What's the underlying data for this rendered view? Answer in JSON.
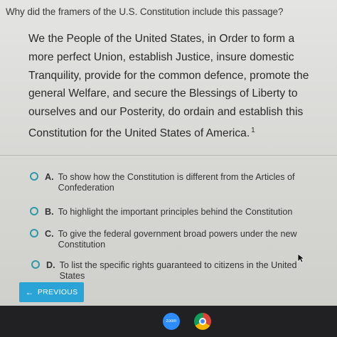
{
  "question": "Why did the framers of the U.S. Constitution include this passage?",
  "passage": {
    "text": "We the People of the United States, in Order to form a more perfect Union, establish Justice, insure domestic Tranquility, provide for the common defence, promote the general Welfare, and secure the Blessings of Liberty to ourselves and our Posterity, do ordain and establish this Constitution for the United States of America.",
    "footnote": "1"
  },
  "options": [
    {
      "letter": "A.",
      "text": "To show how the Constitution is different from the Articles of Confederation"
    },
    {
      "letter": "B.",
      "text": "To highlight the important principles behind the Constitution"
    },
    {
      "letter": "C.",
      "text": "To give the federal government broad powers under the new Constitution"
    },
    {
      "letter": "D.",
      "text": "To list the specific rights guaranteed to citizens in the United States"
    }
  ],
  "navigation": {
    "previous_label": "PREVIOUS"
  },
  "taskbar": {
    "zoom_label": "zoom"
  },
  "colors": {
    "accent": "#2aa3d6",
    "radio_border": "#2e9aa3"
  }
}
